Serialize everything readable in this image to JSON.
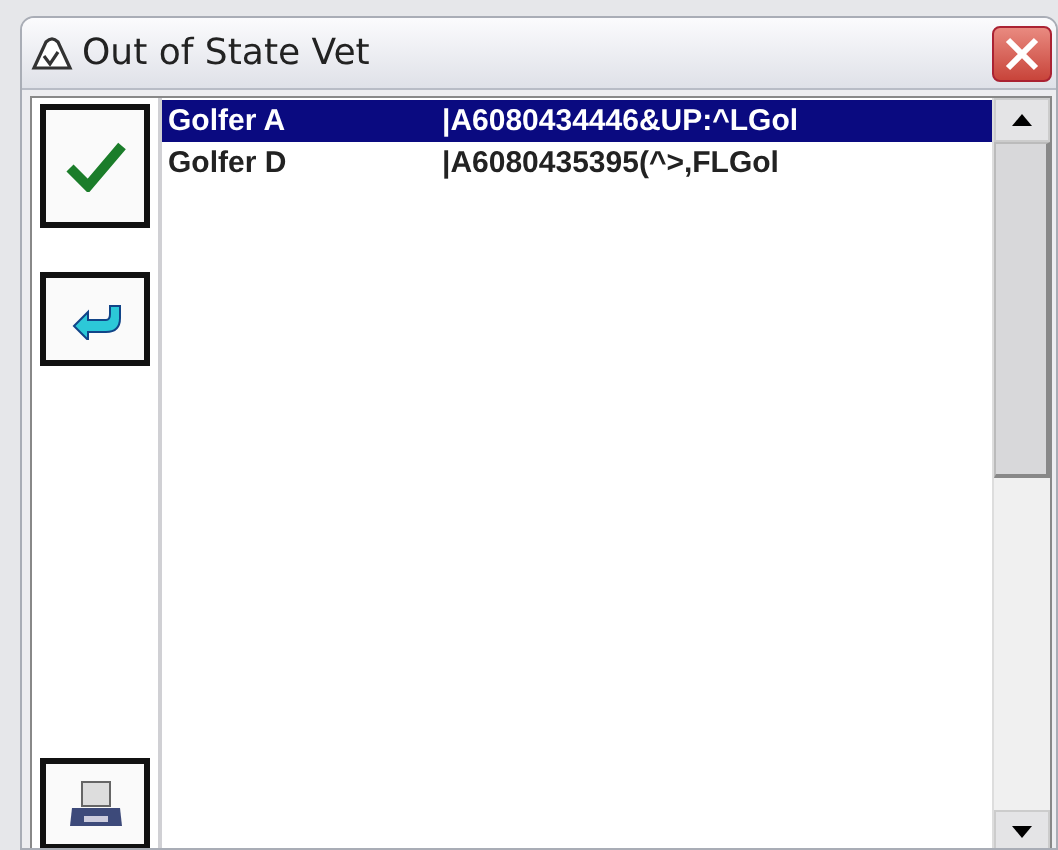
{
  "window": {
    "title": "Out of State Vet"
  },
  "rows": [
    {
      "name": "Golfer A",
      "code": "|A6080434446&UP:^LGol",
      "selected": true
    },
    {
      "name": "Golfer D",
      "code": "|A6080435395(^>,FLGol",
      "selected": false
    }
  ]
}
